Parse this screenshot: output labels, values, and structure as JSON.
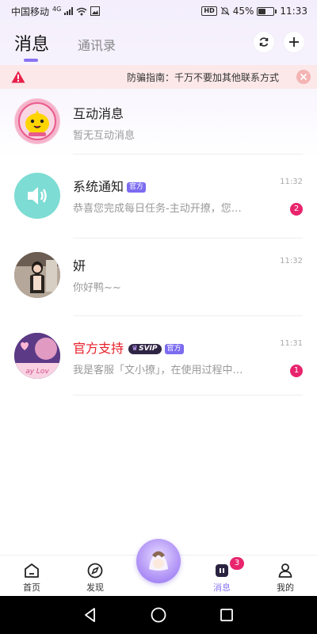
{
  "status_bar": {
    "carrier": "中国移动",
    "network": "4G",
    "battery": "45%",
    "battery_level": 0.45,
    "time": "11:33"
  },
  "header": {
    "active_tab": "消息",
    "inactive_tab": "通讯录",
    "refresh_icon": "refresh-icon",
    "add_icon": "plus-icon"
  },
  "notice": {
    "text": "防骗指南：千万不要加其他联系方式",
    "icon": "warning-icon",
    "close_icon": "close-icon"
  },
  "messages": [
    {
      "name": "互动消息",
      "preview": "暂无互动消息",
      "time": "",
      "count": ""
    },
    {
      "name": "系统通知",
      "tag": "官方",
      "preview": "恭喜您完成每日任务-主动开撩，您…",
      "time": "11:32",
      "count": "2"
    },
    {
      "name": "妍",
      "preview": "你好鸭~~",
      "time": "11:32",
      "count": ""
    },
    {
      "name": "官方支持",
      "svip": "SVIP",
      "tag": "官方",
      "preview": "我是客服「文小撩」，在使用过程中…",
      "time": "11:31",
      "count": "1"
    }
  ],
  "bottom_nav": {
    "items": [
      {
        "label": "首页",
        "icon": "home-icon"
      },
      {
        "label": "发现",
        "icon": "compass-icon"
      },
      {
        "label": "消息",
        "icon": "message-icon"
      },
      {
        "label": "我的",
        "icon": "user-icon"
      }
    ],
    "message_badge": "3"
  },
  "colors": {
    "accent": "#8a74f2",
    "badge": "#e8246d",
    "official_name": "#e8202a"
  }
}
